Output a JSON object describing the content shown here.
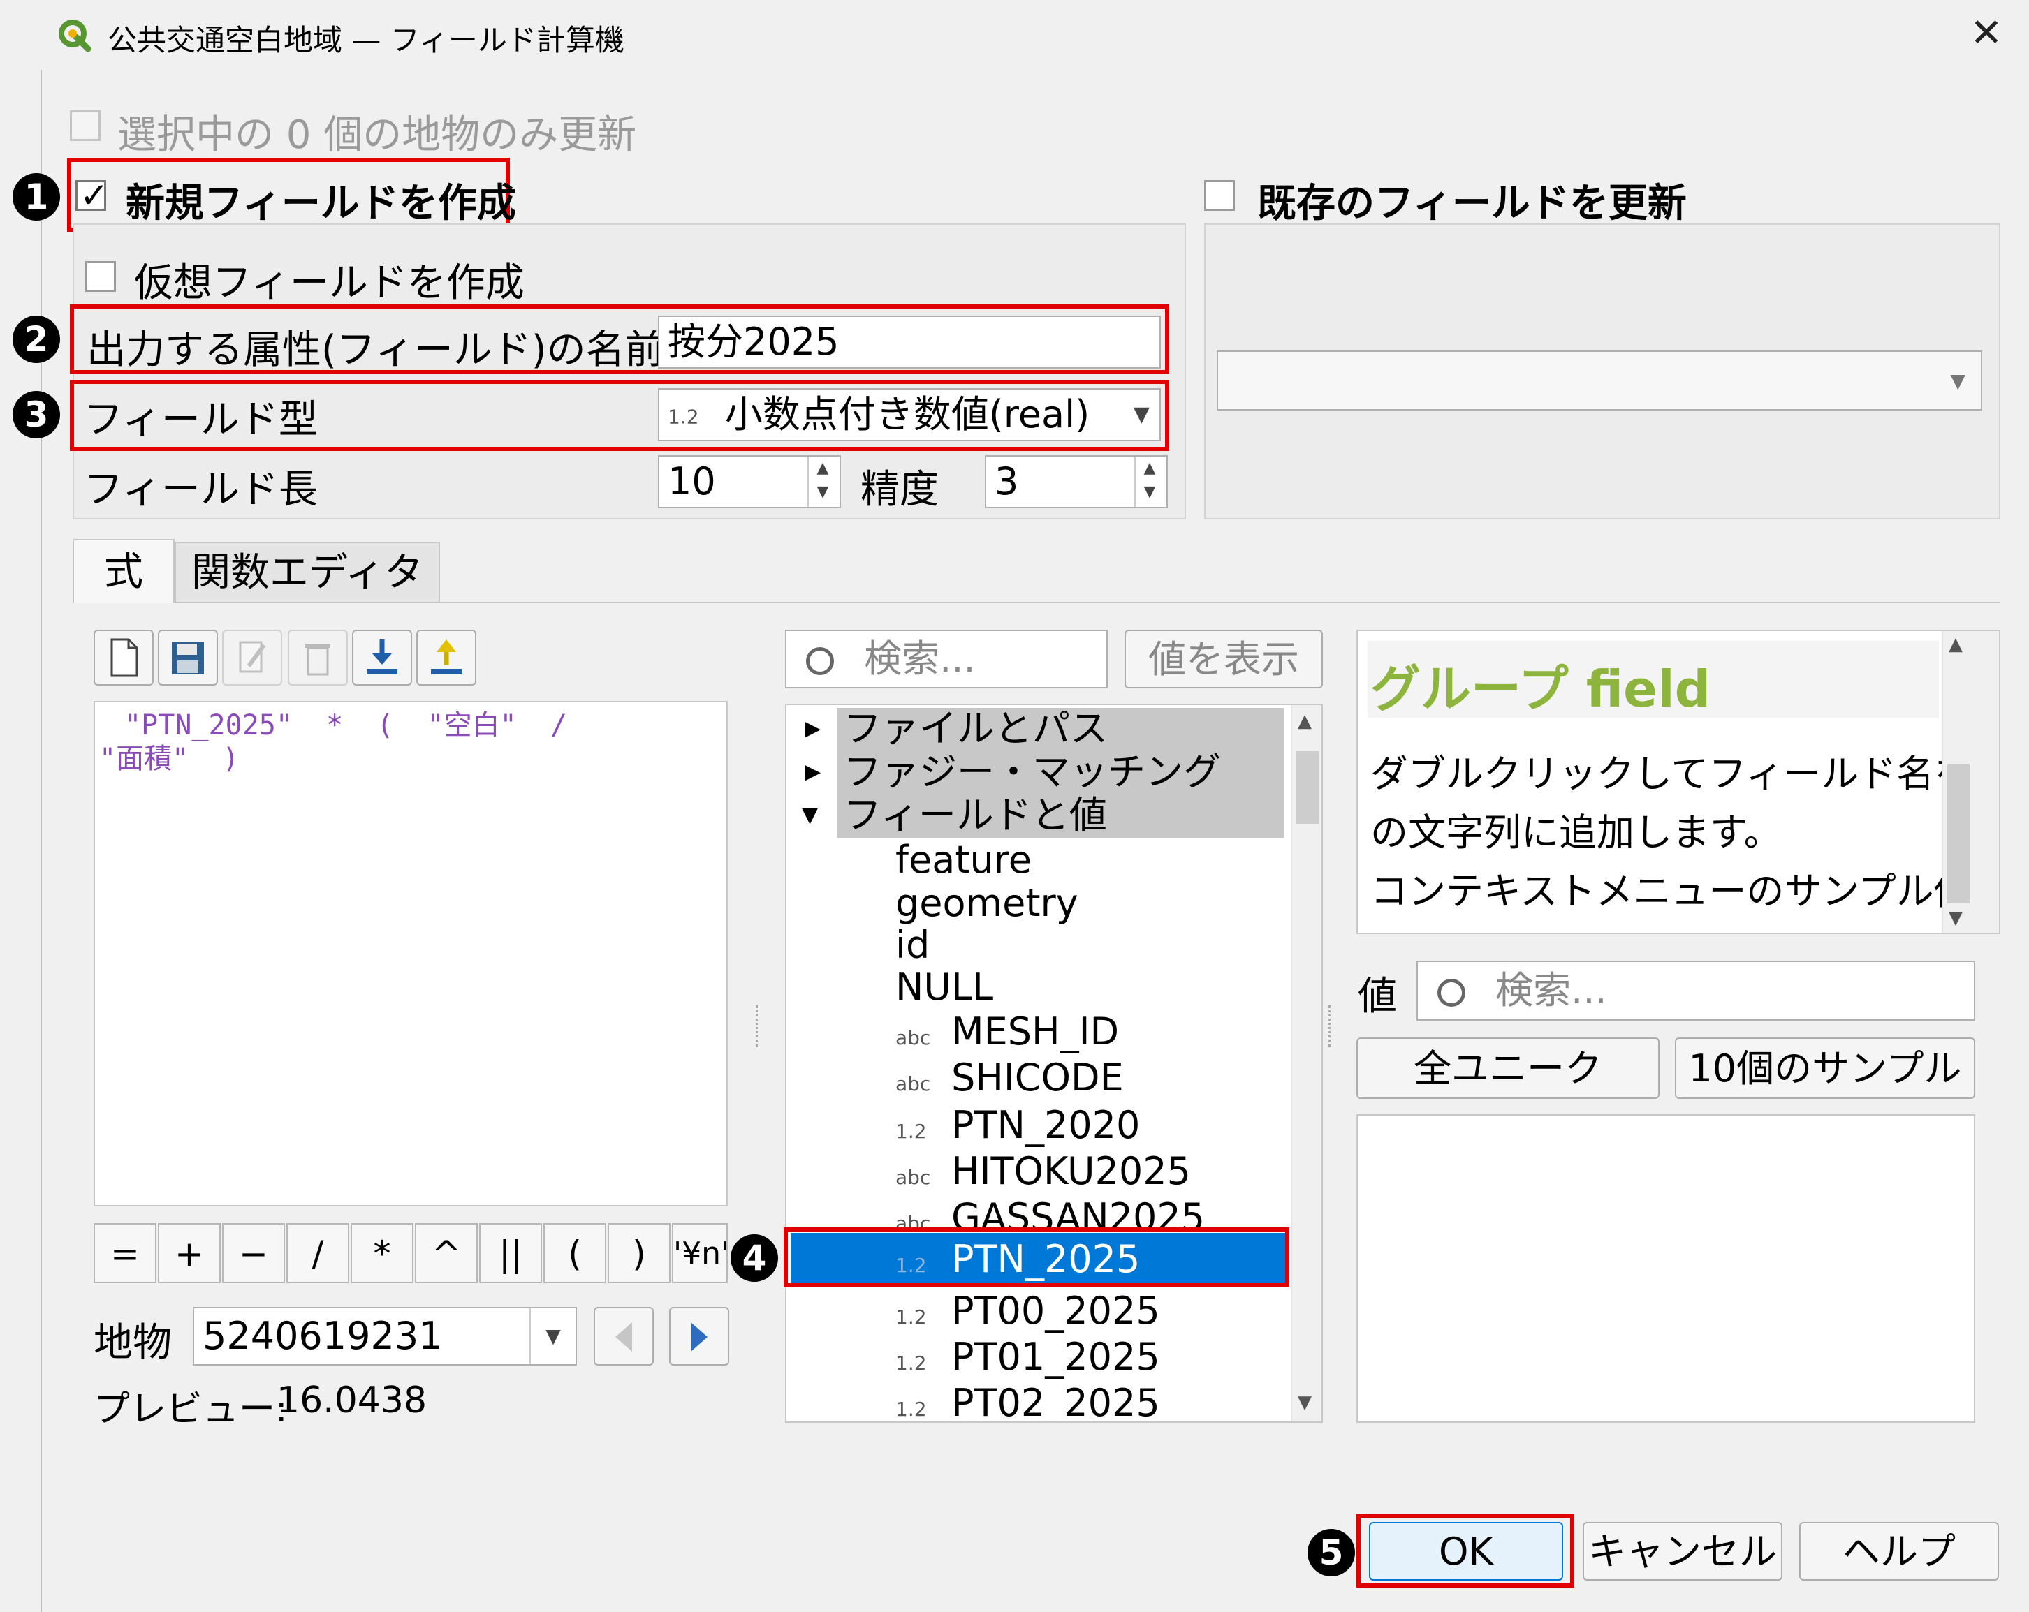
{
  "window": {
    "title": "公共交通空白地域 — フィールド計算機"
  },
  "options": {
    "selected_only": "選択中の 0 個の地物のみ更新",
    "create_new": "新規フィールドを作成",
    "update_existing": "既存のフィールドを更新",
    "virtual_field": "仮想フィールドを作成",
    "output_name_label": "出力する属性(フィールド)の名前",
    "output_name_value": "按分2025",
    "field_type_label": "フィールド型",
    "field_type_badge": "1.2",
    "field_type_value": "小数点付き数値(real)",
    "field_length_label": "フィールド長",
    "field_length_value": "10",
    "precision_label": "精度",
    "precision_value": "3"
  },
  "badges": [
    "1",
    "2",
    "3",
    "4",
    "5"
  ],
  "tabs": [
    "式",
    "関数エディタ"
  ],
  "expression": {
    "line1": " \"PTN_2025\"  *  (  \"空白\"  /",
    "line2": "\"面積\"  )"
  },
  "operators": [
    "=",
    "+",
    "−",
    "/",
    "*",
    "^",
    "||",
    "(",
    ")",
    "'¥n'"
  ],
  "feature": {
    "label": "地物",
    "value": "5240619231"
  },
  "preview": {
    "label": "プレビュー:",
    "value": "16.0438"
  },
  "function_search": {
    "placeholder": "検索...",
    "show_values": "値を表示"
  },
  "tree": {
    "groups": [
      "ファイルとパス",
      "ファジー・マッチング",
      "フィールドと値"
    ],
    "items": [
      {
        "type": "",
        "name": "feature"
      },
      {
        "type": "",
        "name": "geometry"
      },
      {
        "type": "",
        "name": "id"
      },
      {
        "type": "",
        "name": "NULL"
      },
      {
        "type": "abc",
        "name": "MESH_ID"
      },
      {
        "type": "abc",
        "name": "SHICODE"
      },
      {
        "type": "1.2",
        "name": "PTN_2020"
      },
      {
        "type": "abc",
        "name": "HITOKU2025"
      },
      {
        "type": "abc",
        "name": "GASSAN2025"
      },
      {
        "type": "1.2",
        "name": "PTN_2025"
      },
      {
        "type": "1.2",
        "name": "PT00_2025"
      },
      {
        "type": "1.2",
        "name": "PT01_2025"
      },
      {
        "type": "1.2",
        "name": "PT02_2025"
      }
    ]
  },
  "help": {
    "heading": "グループ field",
    "line1": "ダブルクリックしてフィールド名を式",
    "line2": "の文字列に追加します。",
    "line3": "コンテキストメニューのサンプル値読"
  },
  "values_panel": {
    "label": "値",
    "placeholder": "検索...",
    "all_unique": "全ユニーク",
    "sample10": "10個のサンプル"
  },
  "buttons": {
    "ok": "OK",
    "cancel": "キャンセル",
    "help": "ヘルプ"
  },
  "colors": {
    "accent_red": "#e00000",
    "selection_blue": "#0078d7",
    "help_green": "#8db43c"
  }
}
